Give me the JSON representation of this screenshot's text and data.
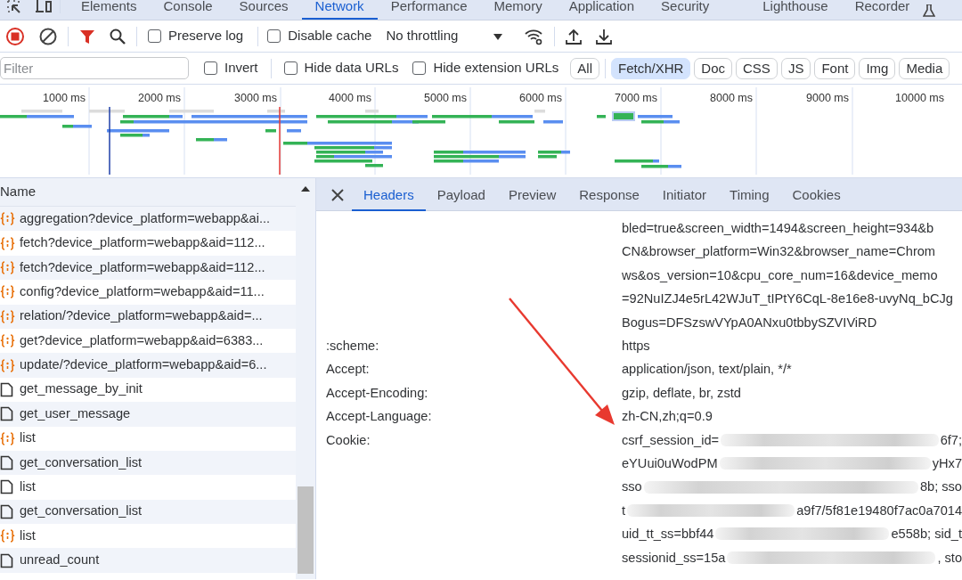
{
  "devtools_tabs": [
    {
      "label": "Elements",
      "selected": false
    },
    {
      "label": "Console",
      "selected": false
    },
    {
      "label": "Sources",
      "selected": false
    },
    {
      "label": "Network",
      "selected": true
    },
    {
      "label": "Performance",
      "selected": false
    },
    {
      "label": "Memory",
      "selected": false
    },
    {
      "label": "Application",
      "selected": false
    },
    {
      "label": "Security",
      "selected": false
    },
    {
      "label": "Lighthouse",
      "selected": false
    },
    {
      "label": "Recorder",
      "selected": false
    }
  ],
  "toolbar": {
    "recording": true,
    "options": [
      {
        "label": "Preserve log",
        "checked": false
      },
      {
        "label": "Disable cache",
        "checked": false
      }
    ],
    "throttling": "No throttling"
  },
  "filter": {
    "placeholder": "Filter",
    "options": [
      {
        "label": "Invert",
        "checked": false
      },
      {
        "label": "Hide data URLs",
        "checked": false
      },
      {
        "label": "Hide extension URLs",
        "checked": false
      }
    ],
    "types": [
      {
        "label": "All",
        "selected": false
      },
      {
        "label": "Fetch/XHR",
        "selected": true
      },
      {
        "label": "Doc",
        "selected": false
      },
      {
        "label": "CSS",
        "selected": false
      },
      {
        "label": "JS",
        "selected": false
      },
      {
        "label": "Font",
        "selected": false
      },
      {
        "label": "Img",
        "selected": false
      },
      {
        "label": "Media",
        "selected": false
      }
    ]
  },
  "timeline": {
    "ticks": [
      "1000 ms",
      "2000 ms",
      "3000 ms",
      "4000 ms",
      "5000 ms",
      "6000 ms",
      "7000 ms",
      "8000 ms",
      "9000 ms",
      "10000 ms"
    ]
  },
  "requests": {
    "column": "Name",
    "rows": [
      {
        "kind": "xhr",
        "name": "aggregation?device_platform=webapp&ai..."
      },
      {
        "kind": "xhr",
        "name": "fetch?device_platform=webapp&aid=112..."
      },
      {
        "kind": "xhr",
        "name": "fetch?device_platform=webapp&aid=112..."
      },
      {
        "kind": "xhr",
        "name": "config?device_platform=webapp&aid=11..."
      },
      {
        "kind": "xhr",
        "name": "relation/?device_platform=webapp&aid=..."
      },
      {
        "kind": "xhr",
        "name": "get?device_platform=webapp&aid=6383..."
      },
      {
        "kind": "xhr",
        "name": "update/?device_platform=webapp&aid=6..."
      },
      {
        "kind": "doc",
        "name": "get_message_by_init"
      },
      {
        "kind": "doc",
        "name": "get_user_message"
      },
      {
        "kind": "xhr",
        "name": "list"
      },
      {
        "kind": "doc",
        "name": "get_conversation_list"
      },
      {
        "kind": "doc",
        "name": "list"
      },
      {
        "kind": "doc",
        "name": "get_conversation_list"
      },
      {
        "kind": "xhr",
        "name": "list"
      },
      {
        "kind": "doc",
        "name": "unread_count"
      }
    ]
  },
  "detail_tabs": [
    {
      "label": "Headers",
      "selected": true
    },
    {
      "label": "Payload",
      "selected": false
    },
    {
      "label": "Preview",
      "selected": false
    },
    {
      "label": "Response",
      "selected": false
    },
    {
      "label": "Initiator",
      "selected": false
    },
    {
      "label": "Timing",
      "selected": false
    },
    {
      "label": "Cookies",
      "selected": false
    }
  ],
  "headers": {
    "continuation_lines": [
      "bled=true&screen_width=1494&screen_height=934&b",
      "CN&browser_platform=Win32&browser_name=Chrom",
      "ws&os_version=10&cpu_core_num=16&device_memo",
      "=92NuIZJ4e5rL42WJuT_tIPtY6CqL-8e16e8-uvyNq_bCJg",
      "Bogus=DFSzswVYpA0ANxu0tbbySZVIViRD"
    ],
    "rows": [
      {
        "name": ":scheme:",
        "lines": [
          {
            "kind": "plain",
            "text": "https"
          }
        ]
      },
      {
        "name": "Accept:",
        "lines": [
          {
            "kind": "plain",
            "text": "application/json, text/plain, */*"
          }
        ]
      },
      {
        "name": "Accept-Encoding:",
        "lines": [
          {
            "kind": "plain",
            "text": "gzip, deflate, br, zstd"
          }
        ]
      },
      {
        "name": "Accept-Language:",
        "lines": [
          {
            "kind": "plain",
            "text": "zh-CN,zh;q=0.9"
          }
        ]
      },
      {
        "name": "Cookie:",
        "lines": [
          {
            "kind": "redacted",
            "before": "csrf_session_id=",
            "after": "6f7;"
          },
          {
            "kind": "redacted",
            "before": "eYUui0uWodPM",
            "after": "yHx7"
          },
          {
            "kind": "redacted",
            "before": "sso",
            "after": "8b; sso"
          },
          {
            "kind": "redacted",
            "before": "t",
            "after": "a9f7/5f81e19480f7ac0a7014"
          },
          {
            "kind": "redacted",
            "before": "uid_tt_ss=bbf44",
            "after": "e558b; sid_t"
          },
          {
            "kind": "redacted",
            "before": "sessionid_ss=15a",
            "after": ", sto"
          }
        ]
      }
    ]
  }
}
